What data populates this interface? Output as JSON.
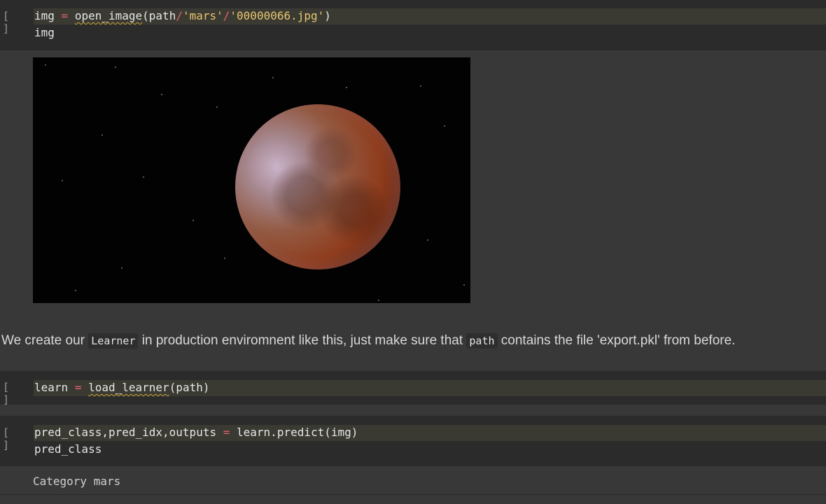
{
  "cells": {
    "cell1": {
      "run_label": "[ ]",
      "line1": {
        "var": "img",
        "op": "=",
        "func": "open_image",
        "p1": "(path",
        "slash1": "/",
        "str1": "'mars'",
        "slash2": "/",
        "str2": "'00000066.jpg'",
        "close": ")"
      },
      "line2": "img"
    },
    "markdown": {
      "text1": "We create our ",
      "code1": "Learner",
      "text2": " in production enviromnent like this, just make sure that ",
      "code2": "path",
      "text3": " contains the file 'export.pkl' from before."
    },
    "cell2": {
      "run_label": "[ ]",
      "line1": {
        "var": "learn",
        "op": "=",
        "func": "load_learner",
        "rest": "(path)"
      }
    },
    "cell3": {
      "run_label": "[ ]",
      "line1": {
        "var": "pred_class,pred_idx,outputs",
        "op": "=",
        "rest": "learn.predict(img)"
      },
      "line2": "pred_class",
      "output": "Category mars"
    }
  },
  "colors": {
    "background": "#383838",
    "code_cell": "#2b2b2b",
    "operator": "#e0626d",
    "string": "#e8c66e"
  }
}
